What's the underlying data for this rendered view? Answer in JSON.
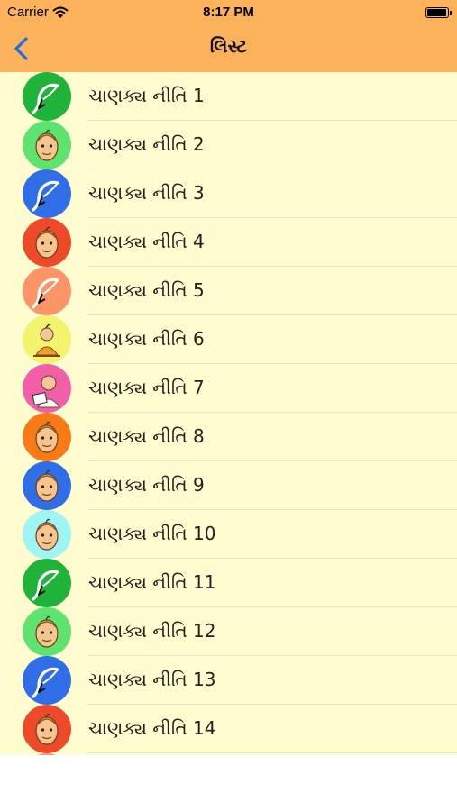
{
  "status_bar": {
    "carrier": "Carrier",
    "time": "8:17 PM",
    "battery_level": 0.95
  },
  "nav": {
    "title": "લિસ્ટ",
    "back_icon": "chevron-left-icon"
  },
  "colors": {
    "header": "#fbb25a",
    "list_background": "#fffdcf",
    "back_tint": "#1a6ee8"
  },
  "items": [
    {
      "label": "ચાણક્ય નીતિ 1",
      "avatar_color": "#1fb33a",
      "avatar_icon": "feather-icon"
    },
    {
      "label": "ચાણક્ય નીતિ 2",
      "avatar_color": "#5ee36f",
      "avatar_icon": "chanakya-face-icon"
    },
    {
      "label": "ચાણક્ય નીતિ 3",
      "avatar_color": "#2f6ee6",
      "avatar_icon": "feather-icon"
    },
    {
      "label": "ચાણક્ય નીતિ 4",
      "avatar_color": "#ee4a2a",
      "avatar_icon": "chanakya-face-icon"
    },
    {
      "label": "ચાણક્ય નીતિ 5",
      "avatar_color": "#fb9466",
      "avatar_icon": "feather-icon"
    },
    {
      "label": "ચાણક્ય નીતિ 6",
      "avatar_color": "#f3f36d",
      "avatar_icon": "chanakya-sitting-icon"
    },
    {
      "label": "ચાણક્ય નીતિ 7",
      "avatar_color": "#f25fa6",
      "avatar_icon": "chanakya-writing-icon"
    },
    {
      "label": "ચાણક્ય નીતિ 8",
      "avatar_color": "#f77a16",
      "avatar_icon": "chanakya-face-icon"
    },
    {
      "label": "ચાણક્ય નીતિ 9",
      "avatar_color": "#2f6ee6",
      "avatar_icon": "chanakya-face-icon"
    },
    {
      "label": "ચાણક્ય નીતિ 10",
      "avatar_color": "#9ff5f3",
      "avatar_icon": "chanakya-face-icon"
    },
    {
      "label": "ચાણક્ય નીતિ 11",
      "avatar_color": "#1fb33a",
      "avatar_icon": "feather-icon"
    },
    {
      "label": "ચાણક્ય નીતિ 12",
      "avatar_color": "#5ee36f",
      "avatar_icon": "chanakya-face-icon"
    },
    {
      "label": "ચાણક્ય નીતિ 13",
      "avatar_color": "#2f6ee6",
      "avatar_icon": "feather-icon"
    },
    {
      "label": "ચાણક્ય નીતિ 14",
      "avatar_color": "#ee4a2a",
      "avatar_icon": "chanakya-face-icon"
    },
    {
      "label": "",
      "avatar_color": "#fb9466",
      "avatar_icon": "feather-icon"
    }
  ]
}
